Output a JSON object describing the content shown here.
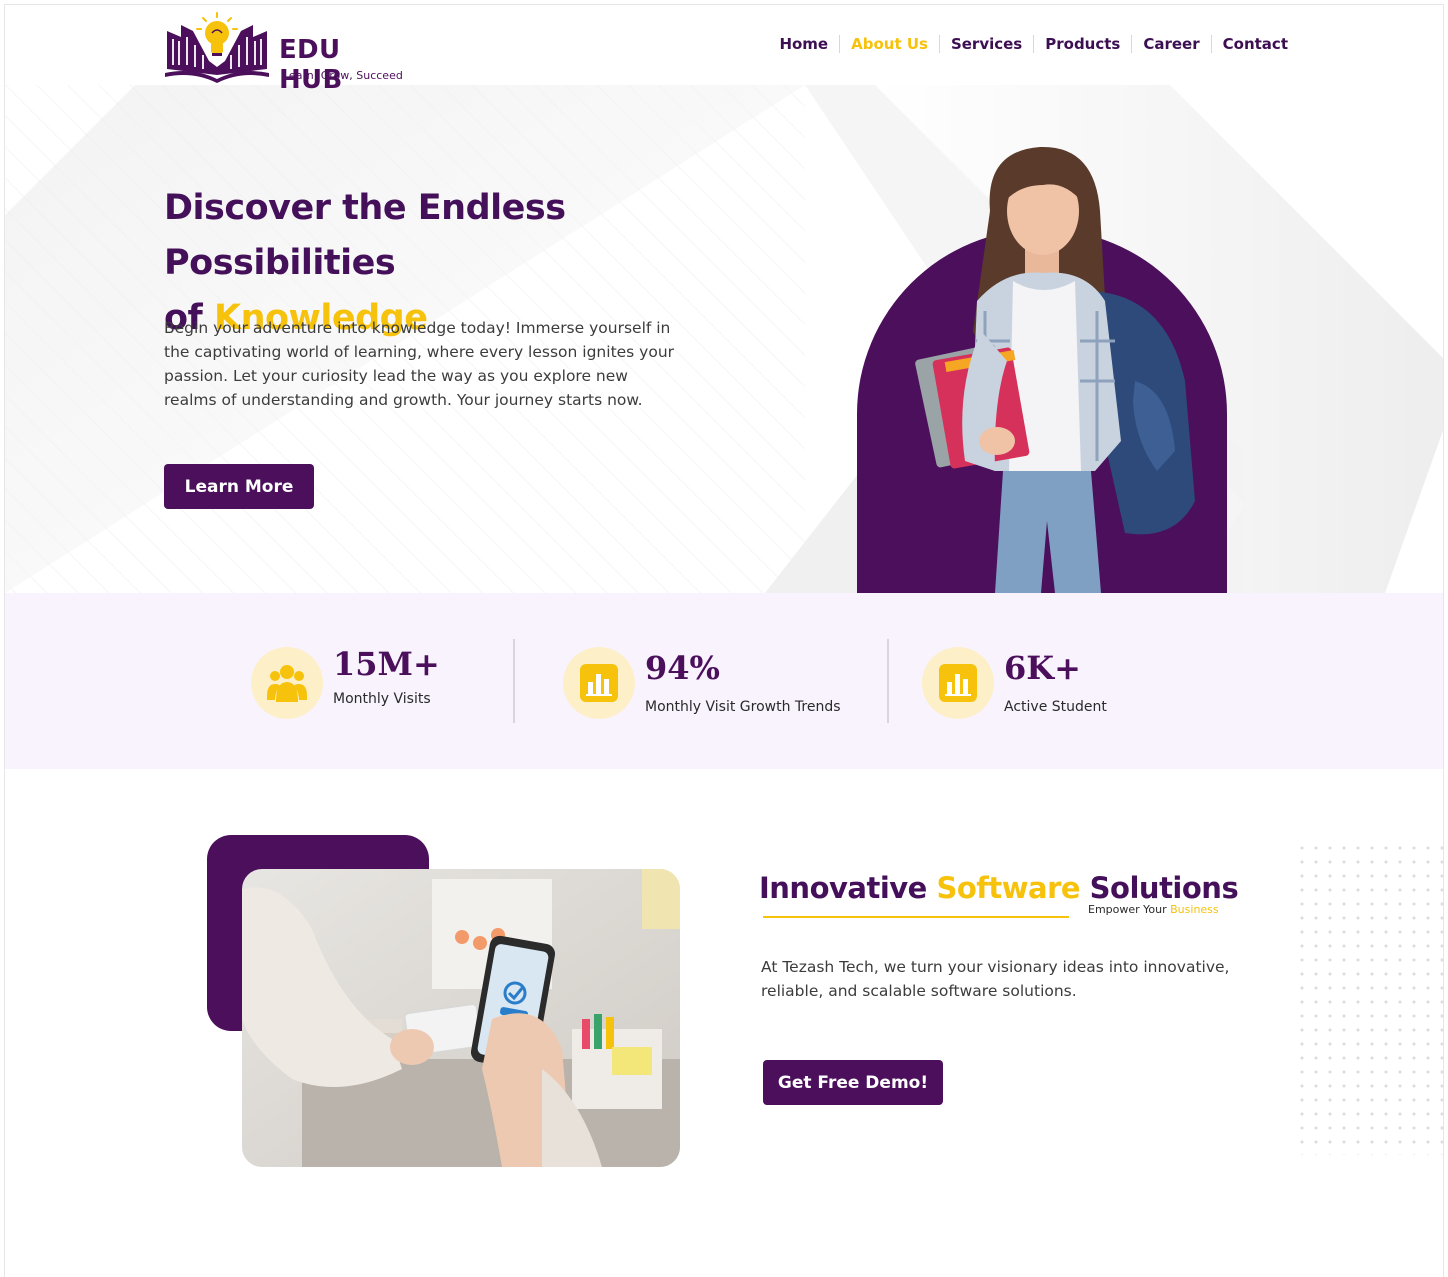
{
  "brand": {
    "name": "EDU HUB",
    "tagline": "Learn, Grow, Succeed"
  },
  "nav": {
    "items": [
      {
        "label": "Home",
        "active": false
      },
      {
        "label": "About Us",
        "active": true
      },
      {
        "label": "Services",
        "active": false
      },
      {
        "label": "Products",
        "active": false
      },
      {
        "label": "Career",
        "active": false
      },
      {
        "label": "Contact",
        "active": false
      }
    ]
  },
  "hero": {
    "title_line1": "Discover the Endless Possibilities",
    "title_line2_prefix": "of ",
    "title_line2_highlight": "Knowledge",
    "description": "Begin your adventure into knowledge today! Immerse yourself in the captivating world of learning, where every lesson ignites your passion. Let your curiosity lead the way as you explore new realms of understanding and growth. Your journey starts now.",
    "cta_label": "Learn More"
  },
  "stats": [
    {
      "value": "15M+",
      "label": "Monthly Visits",
      "icon": "users-icon"
    },
    {
      "value": "94%",
      "label": "Monthly Visit Growth Trends",
      "icon": "bar-chart-icon"
    },
    {
      "value": "6K+",
      "label": "Active Student",
      "icon": "bar-chart-icon"
    }
  ],
  "solutions": {
    "title_part1": "Innovative ",
    "title_highlight": "Software",
    "title_part2": " Solutions",
    "subtitle_prefix": "Empower Your ",
    "subtitle_highlight": "Business",
    "description": "At Tezash Tech, we turn your visionary ideas into innovative, reliable, and scalable software solutions.",
    "cta_label": "Get Free Demo!"
  },
  "colors": {
    "primary": "#4b0f5c",
    "accent": "#f6c20b",
    "stats_background": "#f8f3fd"
  }
}
